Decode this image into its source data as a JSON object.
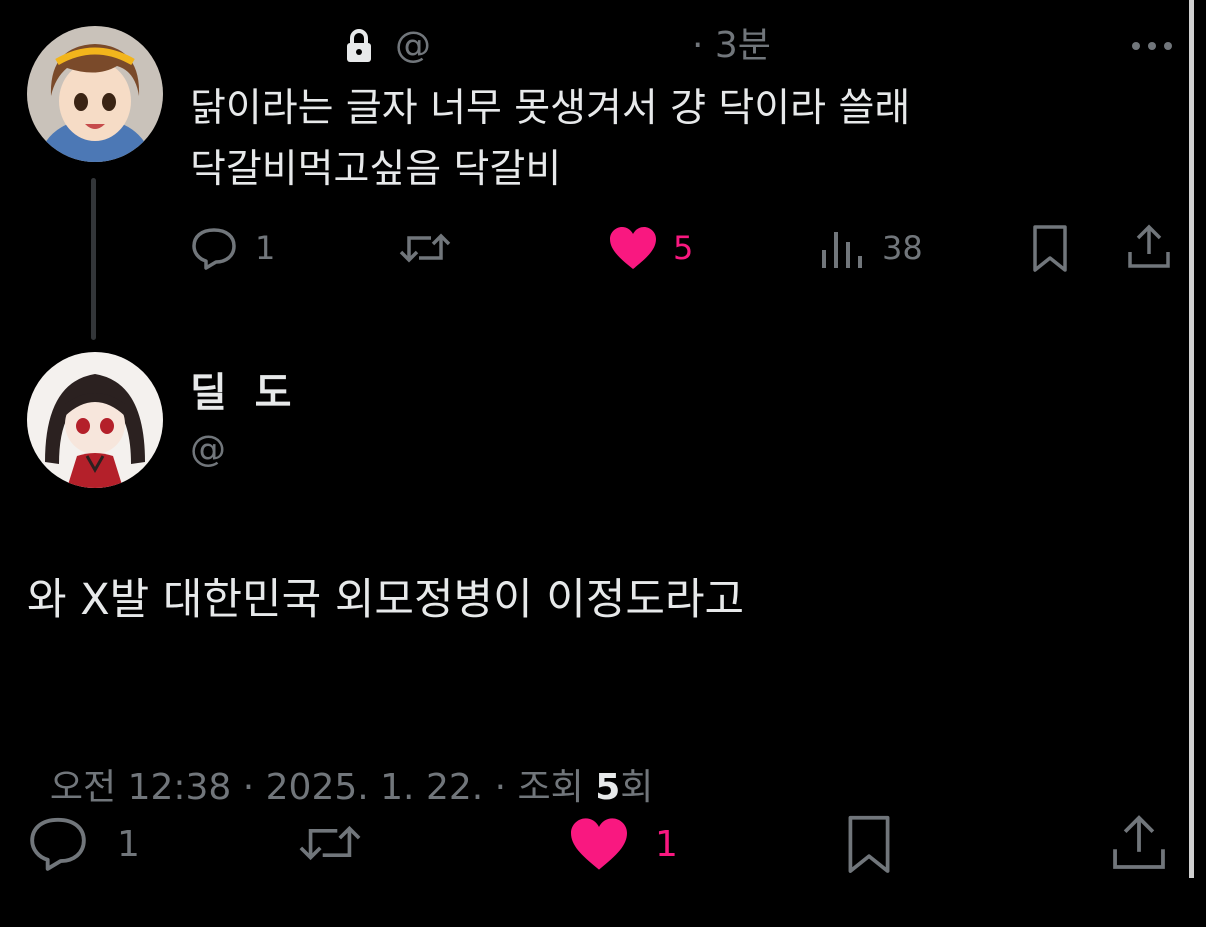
{
  "parent": {
    "handle": "@",
    "time": "· 3분",
    "text_line1": "닭이라는 글자 너무 못생겨서 걍 닥이라 쓸래",
    "text_line2": "닥갈비먹고싶음 닥갈비",
    "stats": {
      "replies": "1",
      "likes": "5",
      "views": "38"
    }
  },
  "reply": {
    "display_name": "딜  도",
    "handle": "@",
    "body": "와 X발 대한민국 외모정병이 이정도라고",
    "meta_prefix": "오전 12:38 · 2025. 1. 22. · 조회 ",
    "views_count": "5",
    "views_suffix": "회",
    "stats": {
      "replies": "1",
      "likes": "1"
    }
  },
  "colors": {
    "background": "#000000",
    "text": "#e7e9ea",
    "muted": "#71767b",
    "like": "#f91880",
    "divider": "#333639"
  },
  "icons": [
    "lock-icon",
    "more-icon",
    "reply-icon",
    "retweet-icon",
    "heart-icon",
    "views-icon",
    "bookmark-icon",
    "share-icon"
  ]
}
